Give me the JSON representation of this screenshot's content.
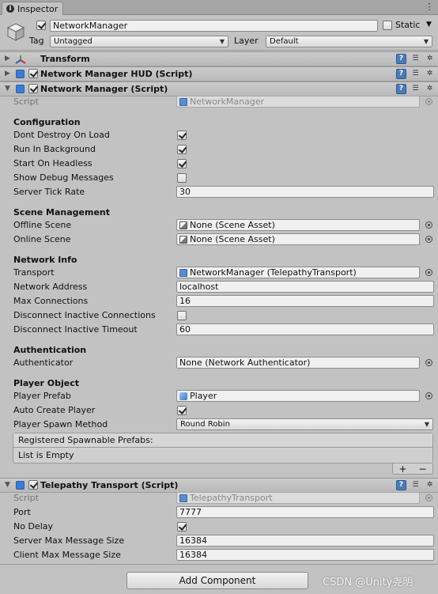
{
  "window": {
    "tab_label": "Inspector"
  },
  "header": {
    "object_name": "NetworkManager",
    "static_label": "Static",
    "tag_label": "Tag",
    "tag_value": "Untagged",
    "layer_label": "Layer",
    "layer_value": "Default"
  },
  "components": {
    "transform": {
      "title": "Transform"
    },
    "hud": {
      "title": "Network Manager HUD (Script)"
    },
    "network_manager": {
      "title": "Network Manager (Script)",
      "script_label": "Script",
      "script_value": "NetworkManager",
      "configuration": {
        "title": "Configuration",
        "dont_destroy_label": "Dont Destroy On Load",
        "run_in_background_label": "Run In Background",
        "start_on_headless_label": "Start On Headless",
        "show_debug_label": "Show Debug Messages",
        "server_tick_rate_label": "Server Tick Rate",
        "server_tick_rate_value": "30"
      },
      "scene_management": {
        "title": "Scene Management",
        "offline_label": "Offline Scene",
        "offline_value": "None (Scene Asset)",
        "online_label": "Online Scene",
        "online_value": "None (Scene Asset)"
      },
      "network_info": {
        "title": "Network Info",
        "transport_label": "Transport",
        "transport_value": "NetworkManager (TelepathyTransport)",
        "address_label": "Network Address",
        "address_value": "localhost",
        "max_conn_label": "Max Connections",
        "max_conn_value": "16",
        "disconnect_inactive_label": "Disconnect Inactive Connections",
        "disconnect_timeout_label": "Disconnect Inactive Timeout",
        "disconnect_timeout_value": "60"
      },
      "authentication": {
        "title": "Authentication",
        "authenticator_label": "Authenticator",
        "authenticator_value": "None (Network Authenticator)"
      },
      "player_object": {
        "title": "Player Object",
        "prefab_label": "Player Prefab",
        "prefab_value": "Player",
        "auto_create_label": "Auto Create Player",
        "spawn_method_label": "Player Spawn Method",
        "spawn_method_value": "Round Robin",
        "spawnable_header": "Registered Spawnable Prefabs:",
        "spawnable_empty": "List is Empty",
        "add_symbol": "+",
        "remove_symbol": "−"
      }
    },
    "telepathy": {
      "title": "Telepathy Transport (Script)",
      "script_label": "Script",
      "script_value": "TelepathyTransport",
      "port_label": "Port",
      "port_value": "7777",
      "no_delay_label": "No Delay",
      "server_max_label": "Server Max Message Size",
      "server_max_value": "16384",
      "client_max_label": "Client Max Message Size",
      "client_max_value": "16384"
    }
  },
  "footer": {
    "add_component_label": "Add Component"
  },
  "watermark": "CSDN @Unity尧明"
}
